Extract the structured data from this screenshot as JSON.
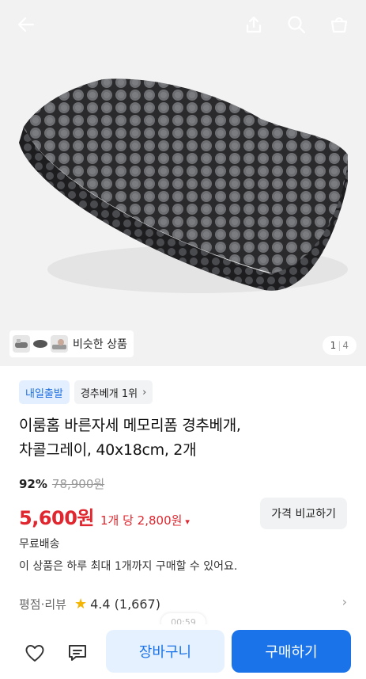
{
  "topbar": {
    "icons": [
      "back-arrow-icon",
      "share-icon",
      "search-icon",
      "cart-icon"
    ]
  },
  "gallery": {
    "similar_label": "비슷한 상품",
    "counter_current": "1",
    "counter_total": "4"
  },
  "product": {
    "badge_delivery": "내일출발",
    "badge_rank": "경추베개 1위",
    "title_line1": "이룸홈 바른자세 메모리폼 경추베개,",
    "title_line2": "차콜그레이, 40x18cm, 2개",
    "discount": "92%",
    "original_price": "78,900원",
    "price": "5,600원",
    "unit_price": "1개 당 2,800원",
    "compare_button": "가격 비교하기",
    "shipping": "무료배송",
    "purchase_limit": "이 상품은 하루 최대 1개까지 구매할 수 있어요.",
    "rating_label": "평점·리뷰",
    "rating_value": "4.4 (1,667)",
    "video_time": "00:59"
  },
  "bottom_bar": {
    "cart_label": "장바구니",
    "buy_label": "구매하기"
  },
  "colors": {
    "accent": "#1a73e8",
    "price": "#e0262e",
    "badge_blue_bg": "#e3efff"
  }
}
